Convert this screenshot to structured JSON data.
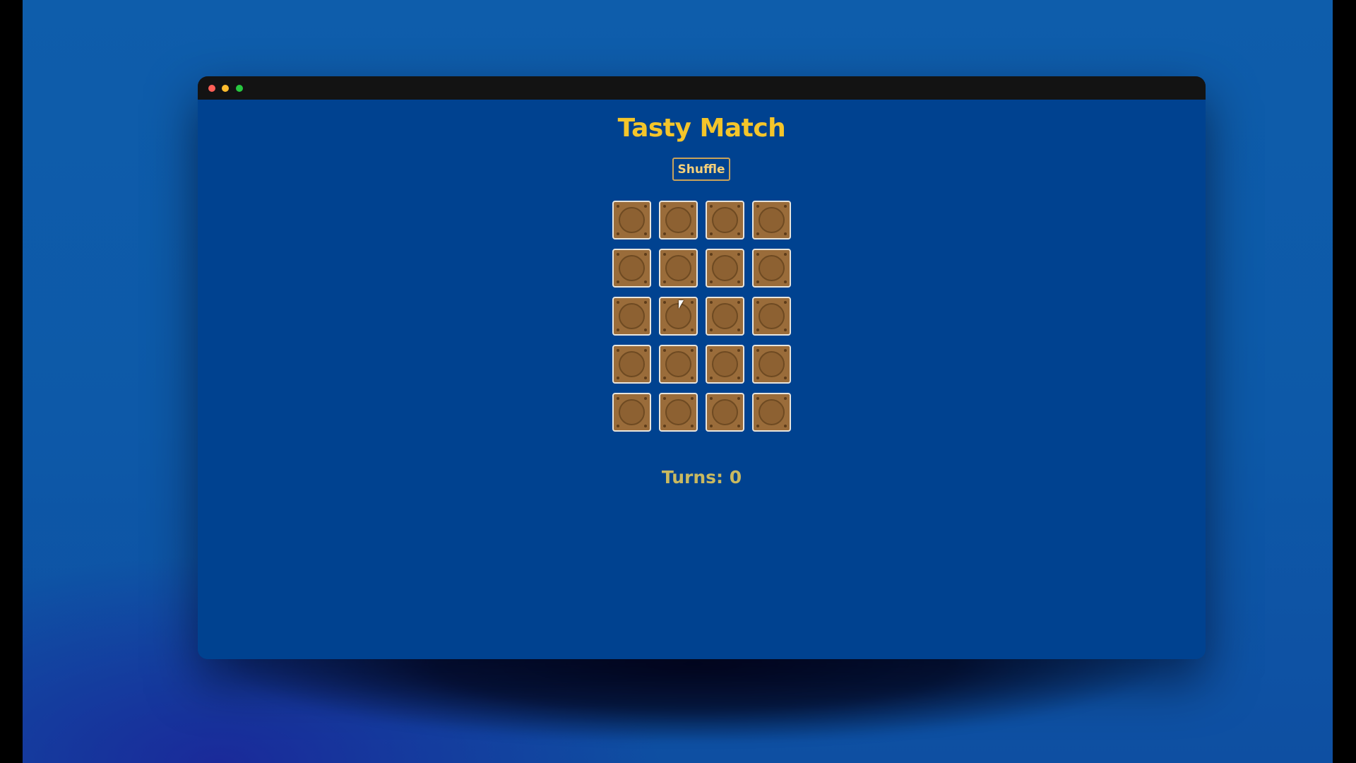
{
  "window": {
    "controls": [
      "close",
      "minimize",
      "maximize"
    ]
  },
  "game": {
    "title": "Tasty Match",
    "shuffle_label": "Shuffle",
    "turns_text": "Turns: 0",
    "grid": {
      "rows": 5,
      "columns": 4,
      "face_down_cards": 20
    }
  },
  "colors": {
    "title": "#f4c52a",
    "card_back": "#9a6c3a",
    "card_border": "#e8e4dc",
    "page_background": "#004290",
    "turns_text": "#c9b960"
  }
}
